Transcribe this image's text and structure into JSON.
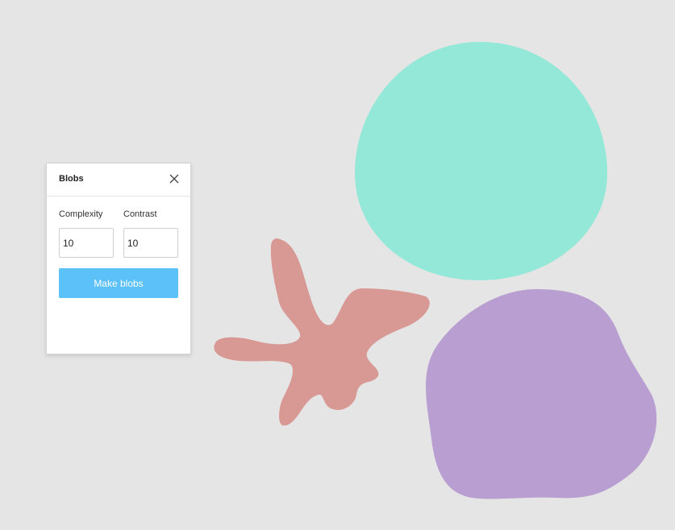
{
  "canvas": {
    "background": "#e5e5e5",
    "blobs": [
      {
        "name": "teal-blob",
        "color": "#93e8d7"
      },
      {
        "name": "purple-blob",
        "color": "#b89ed1"
      },
      {
        "name": "salmon-blob",
        "color": "#d89893"
      }
    ]
  },
  "panel": {
    "title": "Blobs",
    "close_icon": "close-icon",
    "complexity": {
      "label": "Complexity",
      "value": "10"
    },
    "contrast": {
      "label": "Contrast",
      "value": "10"
    },
    "make_button_label": "Make blobs",
    "accent": "#5bc1f8"
  }
}
